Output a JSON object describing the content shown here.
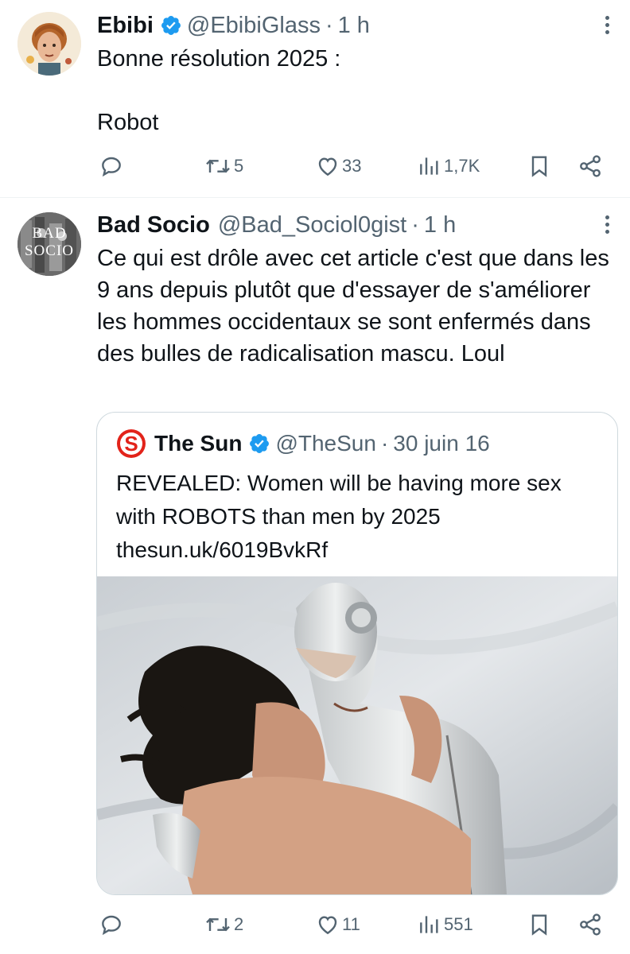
{
  "tweets": [
    {
      "name": "Ebibi",
      "handle": "@EbibiGlass",
      "separator": "·",
      "time": "1 h",
      "text": "Bonne résolution 2025 :\n\nRobot",
      "counts": {
        "replies": "",
        "retweets": "5",
        "likes": "33",
        "views": "1,7K"
      }
    },
    {
      "name": "Bad Socio",
      "handle": "@Bad_Sociol0gist",
      "separator": "·",
      "time": "1 h",
      "avatar_text": "BAD SOCIO",
      "text": "Ce qui est drôle avec cet article c'est que dans les 9 ans depuis plutôt que d'essayer de s'améliorer les hommes occidentaux se sont enfermés dans des bulles de radicalisation mascu. Loul",
      "counts": {
        "replies": "",
        "retweets": "2",
        "likes": "11",
        "views": "551"
      },
      "quote": {
        "name": "The Sun",
        "handle": "@TheSun",
        "separator": "·",
        "time": "30 juin 16",
        "logo_letter": "S",
        "text": "REVEALED: Women will be having more sex with ROBOTS than men by 2025\nthesun.uk/6019BvkRf"
      }
    }
  ],
  "colors": {
    "text": "#0f1419",
    "secondary": "#536471",
    "verified": "#1d9bf0",
    "border": "#cfd9de",
    "sun_red": "#e2231a"
  },
  "icons": [
    "reply-icon",
    "retweet-icon",
    "like-icon",
    "views-icon",
    "bookmark-icon",
    "share-icon",
    "more-icon",
    "verified-icon"
  ]
}
